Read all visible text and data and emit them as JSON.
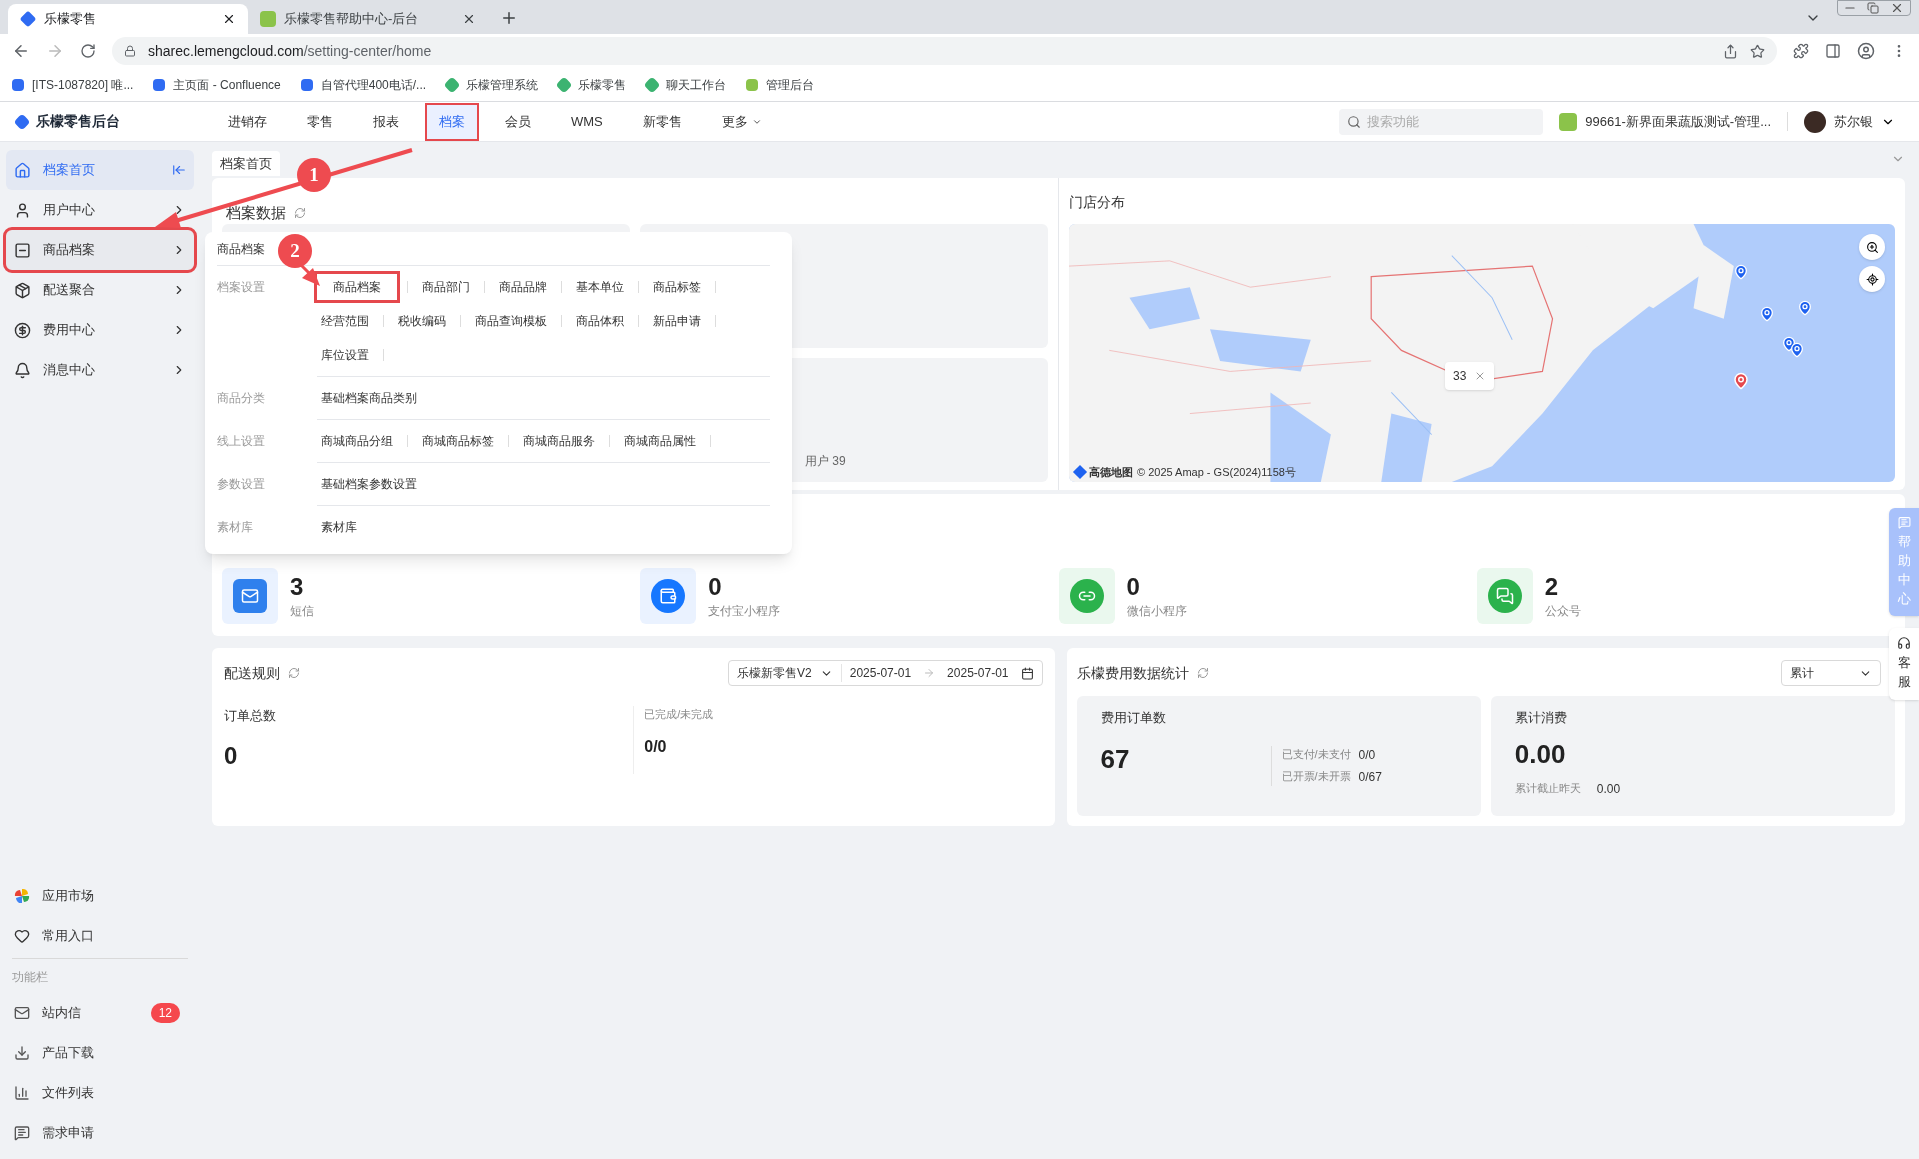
{
  "browser": {
    "tabs": [
      {
        "title": "乐檬零售",
        "selected": true
      },
      {
        "title": "乐檬零售帮助中心-后台",
        "selected": false
      }
    ],
    "url_host": "sharec.lemengcloud.com",
    "url_path": "/setting-center/home",
    "bookmarks": [
      "[ITS-1087820] 唯...",
      "主页面 - Confluence",
      "自管代理400电话/...",
      "乐檬管理系统",
      "乐檬零售",
      "聊天工作台",
      "管理后台"
    ]
  },
  "header": {
    "logo": "乐檬零售后台",
    "nav": [
      {
        "label": "进销存",
        "selected": false,
        "highlighted": false
      },
      {
        "label": "零售",
        "selected": false,
        "highlighted": false
      },
      {
        "label": "报表",
        "selected": false,
        "highlighted": false
      },
      {
        "label": "档案",
        "selected": true,
        "highlighted": true
      },
      {
        "label": "会员",
        "selected": false,
        "highlighted": false
      },
      {
        "label": "WMS",
        "selected": false,
        "highlighted": false
      },
      {
        "label": "新零售",
        "selected": false,
        "highlighted": false
      },
      {
        "label": "更多",
        "selected": false,
        "highlighted": false,
        "kind": "dropdown"
      }
    ],
    "search": {
      "placeholder": "搜索功能"
    },
    "store": "99661-新界面果蔬版测试-管理...",
    "user": "苏尔银"
  },
  "sidebar": {
    "items": [
      {
        "label": "档案首页",
        "selected": true,
        "highlighted": false
      },
      {
        "label": "用户中心",
        "selected": false,
        "highlighted": false
      },
      {
        "label": "商品档案",
        "selected": false,
        "highlighted": true
      },
      {
        "label": "配送聚合",
        "selected": false,
        "highlighted": false
      },
      {
        "label": "费用中心",
        "selected": false,
        "highlighted": false
      },
      {
        "label": "消息中心",
        "selected": false,
        "highlighted": false
      }
    ],
    "shortcuts": [
      "应用市场",
      "常用入口"
    ],
    "section_title": "功能栏",
    "tools": [
      {
        "label": "站内信",
        "badge": "12"
      },
      {
        "label": "产品下载"
      },
      {
        "label": "文件列表"
      },
      {
        "label": "需求申请"
      }
    ]
  },
  "page_tabs": [
    {
      "label": "档案首页",
      "selected": true
    }
  ],
  "archive_data": {
    "title": "档案数据",
    "users": "用户 39"
  },
  "store_map": {
    "title": "门店分布",
    "cluster_count": "33",
    "attribution": "高德地图",
    "copyright": "© 2025 Amap - GS(2024)1158号"
  },
  "channels": [
    {
      "value": "3",
      "label": "短信",
      "kind": "sms"
    },
    {
      "value": "0",
      "label": "支付宝小程序",
      "kind": "alipay"
    },
    {
      "value": "0",
      "label": "微信小程序",
      "kind": "miniprogram"
    },
    {
      "value": "2",
      "label": "公众号",
      "kind": "wechat"
    }
  ],
  "delivery": {
    "title": "配送规则",
    "select": "乐檬新零售V2",
    "date_from": "2025-07-01",
    "date_to": "2025-07-01",
    "stats": [
      {
        "label": "订单总数",
        "value": "0"
      },
      {
        "label": "已完成/未完成",
        "value": "0/0"
      }
    ]
  },
  "fees": {
    "title": "乐檬费用数据统计",
    "select": "累计",
    "cards": [
      {
        "label": "费用订单数",
        "value": "67",
        "details": [
          {
            "label": "已支付/未支付",
            "value": "0/0"
          },
          {
            "label": "已开票/未开票",
            "value": "0/67"
          }
        ]
      },
      {
        "label": "累计消费",
        "value": "0.00",
        "details": [
          {
            "label": "累计截止昨天",
            "value": "0.00"
          }
        ]
      }
    ]
  },
  "float_tabs": [
    "帮助中心",
    "客服"
  ],
  "mega_menu": {
    "title": "商品档案",
    "groups": [
      {
        "label": "档案设置",
        "links": [
          {
            "label": "商品档案",
            "highlighted": true
          },
          {
            "label": "商品部门",
            "highlighted": false
          },
          {
            "label": "商品品牌",
            "highlighted": false
          },
          {
            "label": "基本单位",
            "highlighted": false
          },
          {
            "label": "商品标签",
            "highlighted": false
          },
          {
            "label": "经营范围",
            "highlighted": false
          },
          {
            "label": "税收编码",
            "highlighted": false
          },
          {
            "label": "商品查询模板",
            "highlighted": false
          },
          {
            "label": "商品体积",
            "highlighted": false
          },
          {
            "label": "新品申请",
            "highlighted": false
          },
          {
            "label": "库位设置",
            "highlighted": false
          }
        ]
      },
      {
        "label": "商品分类",
        "links": [
          {
            "label": "基础档案商品类别",
            "highlighted": false
          }
        ]
      },
      {
        "label": "线上设置",
        "links": [
          {
            "label": "商城商品分组",
            "highlighted": false
          },
          {
            "label": "商城商品标签",
            "highlighted": false
          },
          {
            "label": "商城商品服务",
            "highlighted": false
          },
          {
            "label": "商城商品属性",
            "highlighted": false
          }
        ]
      },
      {
        "label": "参数设置",
        "links": [
          {
            "label": "基础档案参数设置",
            "highlighted": false
          }
        ]
      },
      {
        "label": "素材库",
        "links": [
          {
            "label": "素材库",
            "highlighted": false
          }
        ]
      }
    ]
  },
  "annotations": [
    "1",
    "2"
  ]
}
